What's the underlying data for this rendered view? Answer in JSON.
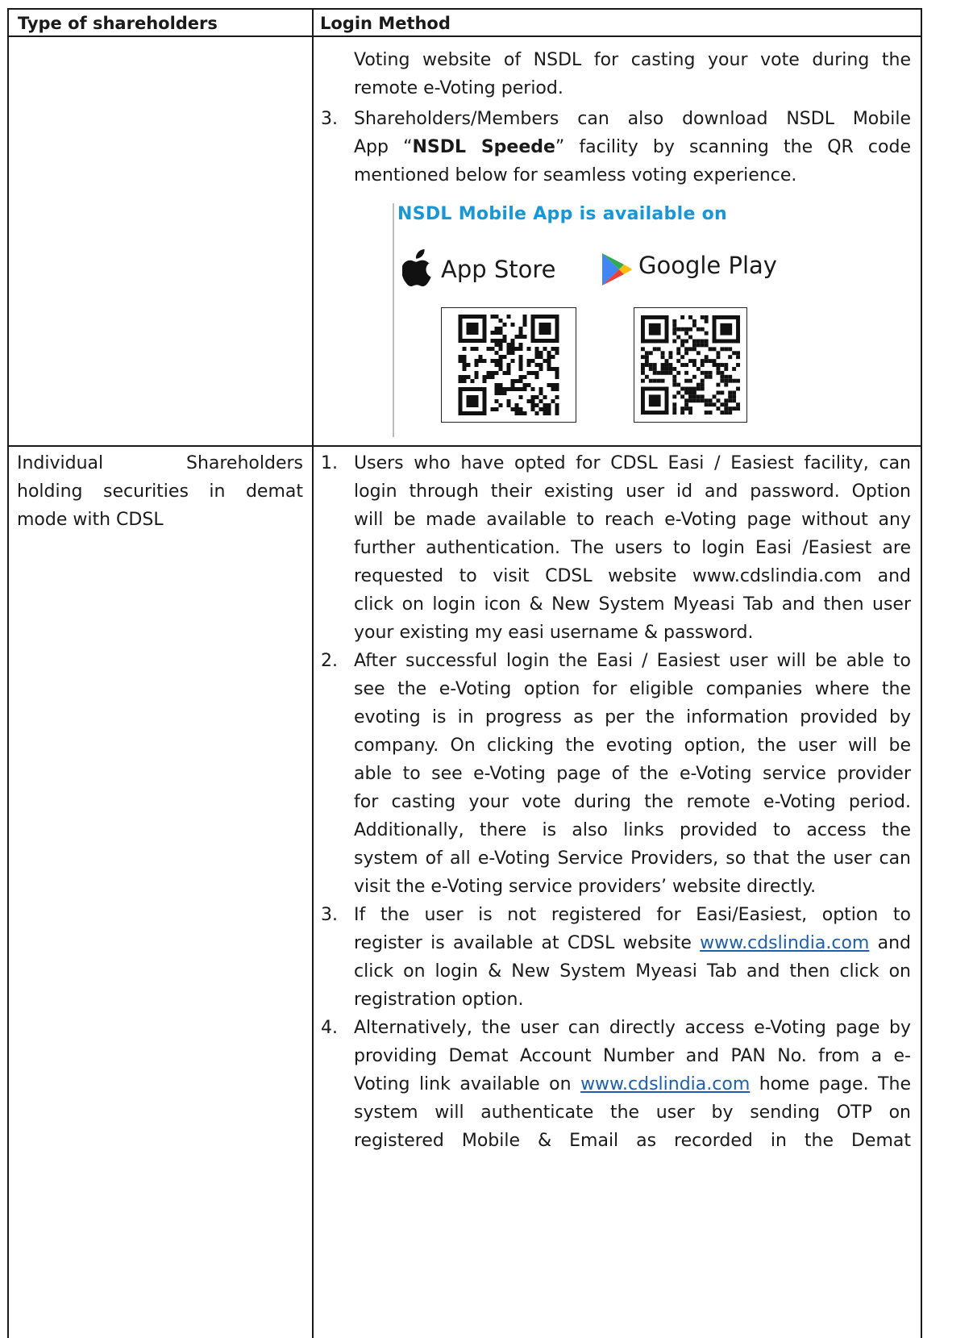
{
  "table": {
    "header": {
      "col1": "Type of shareholders",
      "col2": "Login Method"
    },
    "nsdl_continuation": {
      "line_a": "Voting website of NSDL for casting your vote during the",
      "line_b": "remote e-Voting period.",
      "item3_number": "3.",
      "item3_line1": "Shareholders/Members can also download NSDL Mobile",
      "item3_line2_prefix": "App “",
      "item3_bold": "NSDL Speede",
      "item3_line2_suffix": "” facility by scanning the QR code",
      "item3_line3": "mentioned below for seamless voting experience.",
      "app_promo": {
        "heading": "NSDL Mobile App is available on",
        "app_store_label": "App Store",
        "google_play_label": "Google Play"
      }
    },
    "cdsl_row": {
      "type_line1_left": "Individual",
      "type_line1_right": "Shareholders",
      "type_line2": "holding securities in demat",
      "type_line3": "mode with CDSL",
      "items": [
        {
          "number": "1.",
          "lines": [
            "Users who have opted for CDSL Easi / Easiest facility, can",
            "login through their existing user id and password. Option",
            "will be made available to reach e-Voting page without any",
            "further authentication. The users to login Easi /Easiest are",
            "requested to visit CDSL website www.cdslindia.com and",
            "click on login icon & New System Myeasi Tab and then user",
            "your existing my easi username & password."
          ]
        },
        {
          "number": "2.",
          "lines": [
            "After successful login the Easi / Easiest user will be able to",
            "see the e-Voting option for eligible companies where the",
            "evoting is in progress as per the information provided by",
            "company. On clicking the evoting option, the user will be",
            "able to see e-Voting page of the e-Voting service provider",
            "for casting your vote during the remote e-Voting period.",
            "Additionally, there is also links provided to access the",
            "system of all e-Voting Service Providers, so that the user can",
            "visit the e-Voting service providers’ website directly."
          ]
        },
        {
          "number": "3.",
          "line1": "If the user is not registered for Easi/Easiest, option to",
          "line2_prefix": "register is available at CDSL website ",
          "line2_link": "www.cdslindia.com",
          "line2_suffix": " and",
          "line3": "click on login & New System Myeasi Tab and then click on",
          "line4": "registration option."
        },
        {
          "number": "4.",
          "line1": "Alternatively, the user can directly access e-Voting page by",
          "line2": "providing Demat Account Number and PAN No. from a e-",
          "line3_prefix": "Voting link available on ",
          "line3_link": "www.cdslindia.com",
          "line3_suffix": " home page. The",
          "line4": "system will authenticate the user by sending OTP on",
          "line5": "registered Mobile & Email as recorded in the Demat"
        }
      ]
    }
  },
  "colors": {
    "text": "#1a1a1a",
    "link": "#1f5ea8",
    "app_heading": "#1a96d4",
    "apple_icon": "#111111",
    "play_green": "#34a853",
    "play_blue": "#4285f4",
    "play_yellow": "#fbbc04",
    "play_red": "#ea4335"
  },
  "icons": [
    "apple-logo-icon",
    "google-play-icon",
    "qr-code-app-store",
    "qr-code-google-play"
  ]
}
